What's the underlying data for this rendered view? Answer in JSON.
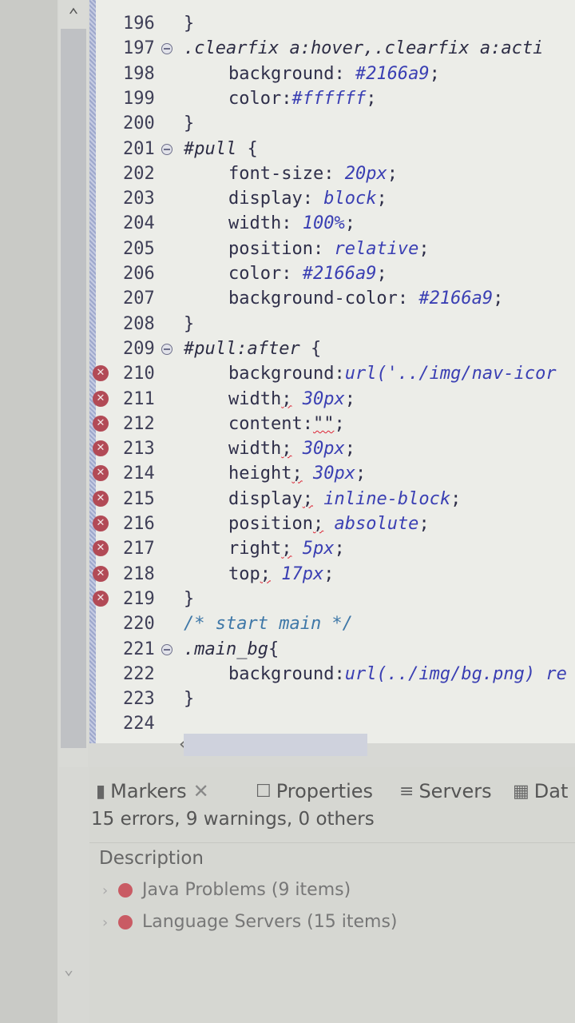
{
  "editor": {
    "lines": [
      {
        "n": "196",
        "fold": false,
        "err": false,
        "indent": 0,
        "parts": [
          {
            "t": "}",
            "k": ""
          }
        ]
      },
      {
        "n": "197",
        "fold": true,
        "err": false,
        "indent": 0,
        "parts": [
          {
            "t": ".clearfix a:hover,.clearfix a:acti",
            "k": "sel"
          }
        ]
      },
      {
        "n": "198",
        "fold": false,
        "err": false,
        "indent": 1,
        "parts": [
          {
            "t": "background: ",
            "k": ""
          },
          {
            "t": "#2166a9",
            "k": "v"
          },
          {
            "t": ";",
            "k": ""
          }
        ]
      },
      {
        "n": "199",
        "fold": false,
        "err": false,
        "indent": 1,
        "parts": [
          {
            "t": "color:",
            "k": ""
          },
          {
            "t": "#ffffff",
            "k": "v"
          },
          {
            "t": ";",
            "k": ""
          }
        ]
      },
      {
        "n": "200",
        "fold": false,
        "err": false,
        "indent": 0,
        "parts": [
          {
            "t": "}",
            "k": ""
          }
        ]
      },
      {
        "n": "201",
        "fold": true,
        "err": false,
        "indent": 0,
        "parts": [
          {
            "t": "#pull",
            "k": "sel"
          },
          {
            "t": " {",
            "k": ""
          }
        ]
      },
      {
        "n": "202",
        "fold": false,
        "err": false,
        "indent": 1,
        "parts": [
          {
            "t": "font-size: ",
            "k": ""
          },
          {
            "t": "20px",
            "k": "v"
          },
          {
            "t": ";",
            "k": ""
          }
        ]
      },
      {
        "n": "203",
        "fold": false,
        "err": false,
        "indent": 1,
        "parts": [
          {
            "t": "display: ",
            "k": ""
          },
          {
            "t": "block",
            "k": "v"
          },
          {
            "t": ";",
            "k": ""
          }
        ]
      },
      {
        "n": "204",
        "fold": false,
        "err": false,
        "indent": 1,
        "parts": [
          {
            "t": "width: ",
            "k": ""
          },
          {
            "t": "100%",
            "k": "v"
          },
          {
            "t": ";",
            "k": ""
          }
        ]
      },
      {
        "n": "205",
        "fold": false,
        "err": false,
        "indent": 1,
        "parts": [
          {
            "t": "position: ",
            "k": ""
          },
          {
            "t": "relative",
            "k": "v"
          },
          {
            "t": ";",
            "k": ""
          }
        ]
      },
      {
        "n": "206",
        "fold": false,
        "err": false,
        "indent": 1,
        "parts": [
          {
            "t": "color: ",
            "k": ""
          },
          {
            "t": "#2166a9",
            "k": "v"
          },
          {
            "t": ";",
            "k": ""
          }
        ]
      },
      {
        "n": "207",
        "fold": false,
        "err": false,
        "indent": 1,
        "parts": [
          {
            "t": "background-color: ",
            "k": ""
          },
          {
            "t": "#2166a9",
            "k": "v"
          },
          {
            "t": ";",
            "k": ""
          }
        ]
      },
      {
        "n": "208",
        "fold": false,
        "err": false,
        "indent": 0,
        "parts": [
          {
            "t": "}",
            "k": ""
          }
        ]
      },
      {
        "n": "209",
        "fold": true,
        "err": false,
        "indent": 0,
        "parts": [
          {
            "t": "#pull:after",
            "k": "sel"
          },
          {
            "t": " {",
            "k": ""
          }
        ]
      },
      {
        "n": "210",
        "fold": false,
        "err": true,
        "indent": 1,
        "parts": [
          {
            "t": "background:",
            "k": ""
          },
          {
            "t": "url('../img/nav-icor",
            "k": "v"
          }
        ]
      },
      {
        "n": "211",
        "fold": false,
        "err": true,
        "indent": 1,
        "parts": [
          {
            "t": "width",
            "k": ""
          },
          {
            "t": ";",
            "k": "u"
          },
          {
            "t": " ",
            "k": ""
          },
          {
            "t": "30px",
            "k": "v"
          },
          {
            "t": ";",
            "k": ""
          }
        ]
      },
      {
        "n": "212",
        "fold": false,
        "err": true,
        "indent": 1,
        "parts": [
          {
            "t": "content:",
            "k": ""
          },
          {
            "t": "\"\"",
            "k": "u"
          },
          {
            "t": ";",
            "k": ""
          }
        ]
      },
      {
        "n": "213",
        "fold": false,
        "err": true,
        "indent": 1,
        "parts": [
          {
            "t": "width",
            "k": ""
          },
          {
            "t": ";",
            "k": "u"
          },
          {
            "t": " ",
            "k": ""
          },
          {
            "t": "30px",
            "k": "v"
          },
          {
            "t": ";",
            "k": ""
          }
        ]
      },
      {
        "n": "214",
        "fold": false,
        "err": true,
        "indent": 1,
        "parts": [
          {
            "t": "height",
            "k": ""
          },
          {
            "t": ";",
            "k": "u"
          },
          {
            "t": " ",
            "k": ""
          },
          {
            "t": "30px",
            "k": "v"
          },
          {
            "t": ";",
            "k": ""
          }
        ]
      },
      {
        "n": "215",
        "fold": false,
        "err": true,
        "indent": 1,
        "parts": [
          {
            "t": "display",
            "k": ""
          },
          {
            "t": ";",
            "k": "u"
          },
          {
            "t": " ",
            "k": ""
          },
          {
            "t": "inline-block",
            "k": "v"
          },
          {
            "t": ";",
            "k": ""
          }
        ]
      },
      {
        "n": "216",
        "fold": false,
        "err": true,
        "indent": 1,
        "parts": [
          {
            "t": "position",
            "k": ""
          },
          {
            "t": ";",
            "k": "u"
          },
          {
            "t": " ",
            "k": ""
          },
          {
            "t": "absolute",
            "k": "v"
          },
          {
            "t": ";",
            "k": ""
          }
        ]
      },
      {
        "n": "217",
        "fold": false,
        "err": true,
        "indent": 1,
        "parts": [
          {
            "t": "right",
            "k": ""
          },
          {
            "t": ";",
            "k": "u"
          },
          {
            "t": " ",
            "k": ""
          },
          {
            "t": "5px",
            "k": "v"
          },
          {
            "t": ";",
            "k": ""
          }
        ]
      },
      {
        "n": "218",
        "fold": false,
        "err": true,
        "indent": 1,
        "parts": [
          {
            "t": "top",
            "k": ""
          },
          {
            "t": ";",
            "k": "u"
          },
          {
            "t": " ",
            "k": ""
          },
          {
            "t": "17px",
            "k": "v"
          },
          {
            "t": ";",
            "k": ""
          }
        ]
      },
      {
        "n": "219",
        "fold": false,
        "err": true,
        "indent": 0,
        "parts": [
          {
            "t": "}",
            "k": ""
          }
        ]
      },
      {
        "n": "220",
        "fold": false,
        "err": false,
        "indent": 0,
        "parts": [
          {
            "t": "/* start main */",
            "k": "c"
          }
        ]
      },
      {
        "n": "221",
        "fold": true,
        "err": false,
        "indent": 0,
        "parts": [
          {
            "t": ".main_bg",
            "k": "sel"
          },
          {
            "t": "{",
            "k": ""
          }
        ]
      },
      {
        "n": "222",
        "fold": false,
        "err": false,
        "indent": 1,
        "parts": [
          {
            "t": "background:",
            "k": ""
          },
          {
            "t": "url(../img/bg.png) re",
            "k": "v"
          }
        ]
      },
      {
        "n": "223",
        "fold": false,
        "err": false,
        "indent": 0,
        "parts": [
          {
            "t": "}",
            "k": ""
          }
        ]
      },
      {
        "n": "224",
        "fold": false,
        "err": false,
        "indent": 0,
        "parts": []
      }
    ]
  },
  "panel": {
    "tabs": [
      {
        "label": "Markers",
        "icon": "markers-icon",
        "closable": true
      },
      {
        "label": "Properties",
        "icon": "properties-icon",
        "closable": false
      },
      {
        "label": "Servers",
        "icon": "servers-icon",
        "closable": false
      },
      {
        "label": "Dat",
        "icon": "data-source-icon",
        "closable": false
      }
    ],
    "summary": "15 errors, 9 warnings, 0 others",
    "column_header": "Description",
    "items": [
      {
        "label": "Java Problems (9 items)"
      },
      {
        "label": "Language Servers (15 items)"
      }
    ]
  }
}
